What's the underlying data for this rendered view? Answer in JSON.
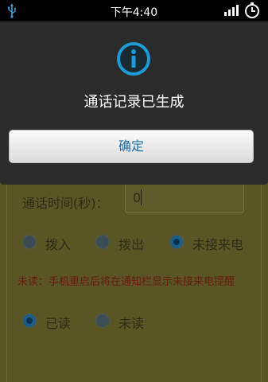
{
  "status_bar": {
    "time": "下午4:40",
    "icons": [
      "usb-icon",
      "signal-icon",
      "battery-icon"
    ]
  },
  "dialog": {
    "icon": "info-icon",
    "title": "通话记录已生成",
    "confirm_label": "确定",
    "accent_color": "#1e9ad6"
  },
  "form": {
    "duration_label": "通话时间(秒)：",
    "duration_value": "0",
    "call_types": [
      {
        "label": "拨入",
        "checked": false
      },
      {
        "label": "拨出",
        "checked": false
      },
      {
        "label": "未接来电",
        "checked": true
      }
    ],
    "note": "未读：手机重启后将在通知栏显示未接来电提醒",
    "read_states": [
      {
        "label": "已读",
        "checked": true
      },
      {
        "label": "未读",
        "checked": false
      }
    ]
  }
}
